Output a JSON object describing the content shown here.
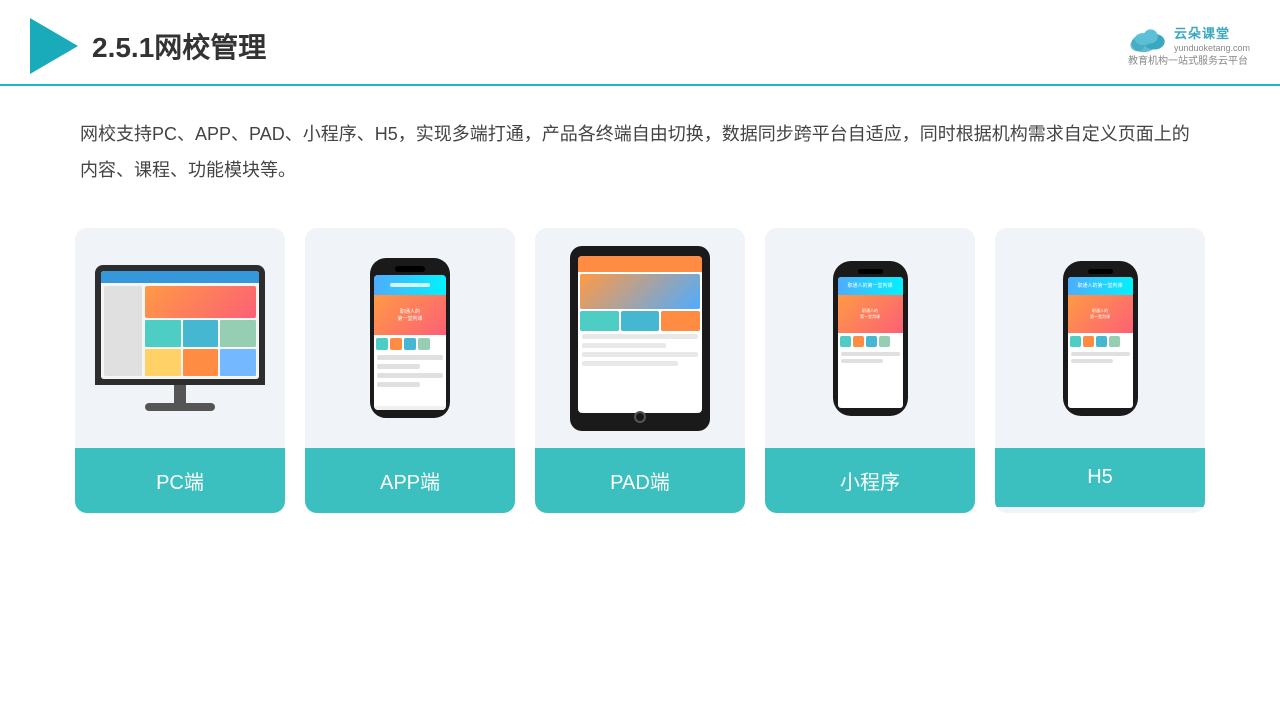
{
  "header": {
    "title": "2.5.1网校管理",
    "brand": {
      "name": "云朵课堂",
      "romanized": "yunduoketang.com",
      "tagline": "教育机构一站\n式服务云平台"
    }
  },
  "description": {
    "text": "网校支持PC、APP、PAD、小程序、H5，实现多端打通，产品各终端自由切换，数据同步跨平台自适应，同时根据机构需求自定义页面上的内容、课程、功能模块等。"
  },
  "cards": [
    {
      "id": "pc",
      "label": "PC端"
    },
    {
      "id": "app",
      "label": "APP端"
    },
    {
      "id": "pad",
      "label": "PAD端"
    },
    {
      "id": "miniprogram",
      "label": "小程序"
    },
    {
      "id": "h5",
      "label": "H5"
    }
  ],
  "colors": {
    "accent": "#1db8c8",
    "card_label_bg": "#3bbfbf",
    "header_border": "#1db8c8"
  }
}
